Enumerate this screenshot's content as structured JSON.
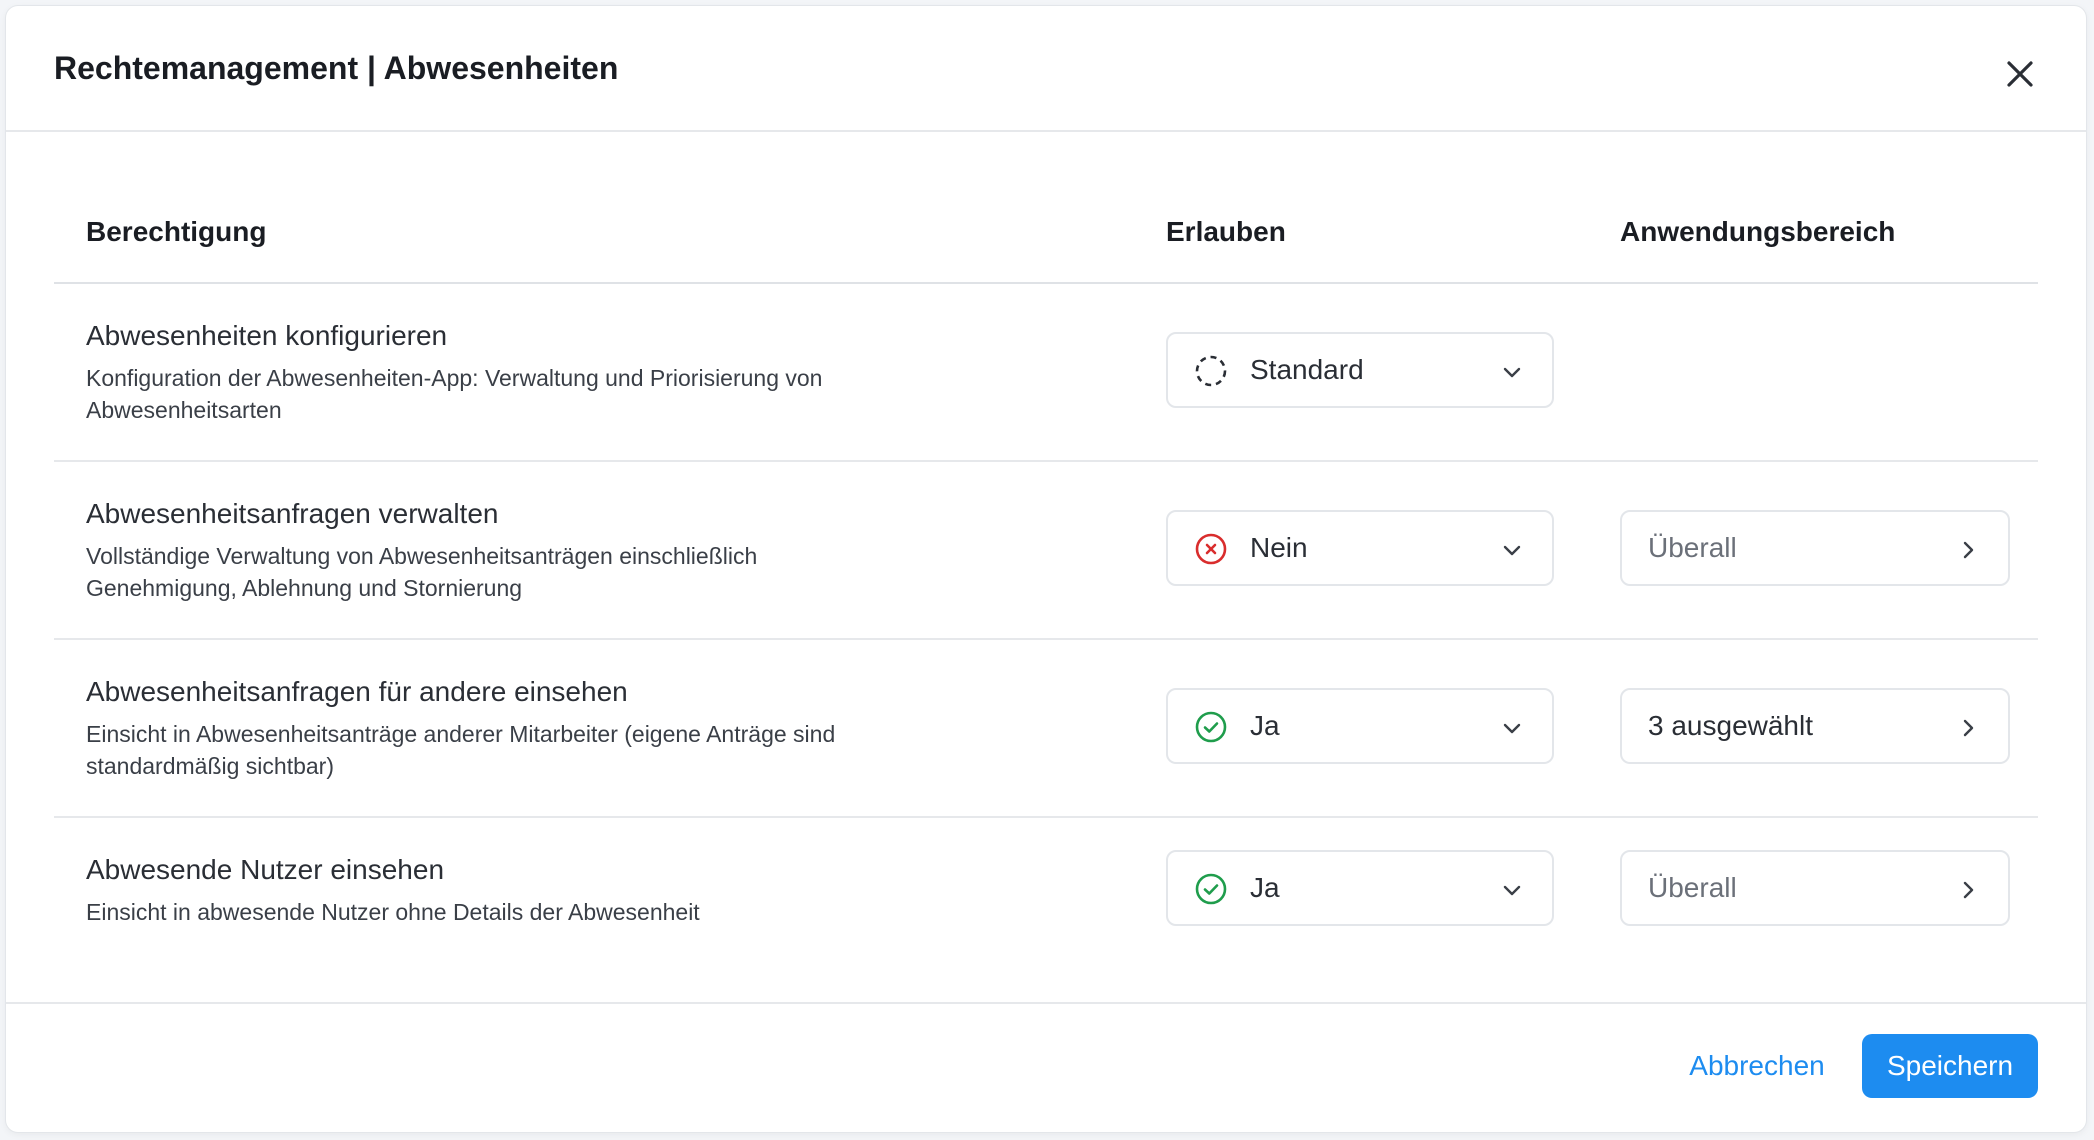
{
  "modal": {
    "title": "Rechtemanagement | Abwesenheiten",
    "close_icon": "close-icon"
  },
  "columns": {
    "permission": "Berechtigung",
    "allow": "Erlauben",
    "scope": "Anwendungsbereich"
  },
  "rows": [
    {
      "title": "Abwesenheiten konfigurieren",
      "description": "Konfiguration der Abwesenheiten-App: Verwaltung und Priorisierung von Abwesenheitsarten",
      "allow": {
        "value": "Standard",
        "icon": "dashed-circle-icon"
      },
      "scope": null
    },
    {
      "title": "Abwesenheitsanfragen verwalten",
      "description": "Vollständige Verwaltung von Abwesenheitsanträgen einschließlich Genehmigung, Ablehnung und Stornierung",
      "allow": {
        "value": "Nein",
        "icon": "x-circle-icon",
        "color": "#d92d2d"
      },
      "scope": {
        "value": "Überall",
        "disabled": true
      }
    },
    {
      "title": "Abwesenheitsanfragen für andere einsehen",
      "description": "Einsicht in Abwesenheitsanträge anderer Mitarbeiter (eigene Anträge sind standardmäßig sichtbar)",
      "allow": {
        "value": "Ja",
        "icon": "check-circle-icon",
        "color": "#1f9d4c"
      },
      "scope": {
        "value": "3 ausgewählt",
        "disabled": false
      }
    },
    {
      "title": "Abwesende Nutzer einsehen",
      "description": "Einsicht in abwesende Nutzer ohne Details der Abwesenheit",
      "allow": {
        "value": "Ja",
        "icon": "check-circle-icon",
        "color": "#1f9d4c"
      },
      "scope": {
        "value": "Überall",
        "disabled": true
      }
    }
  ],
  "footer": {
    "cancel_label": "Abbrechen",
    "save_label": "Speichern"
  },
  "colors": {
    "accent": "#1d8cf0",
    "danger": "#d92d2d",
    "success": "#1f9d4c"
  }
}
